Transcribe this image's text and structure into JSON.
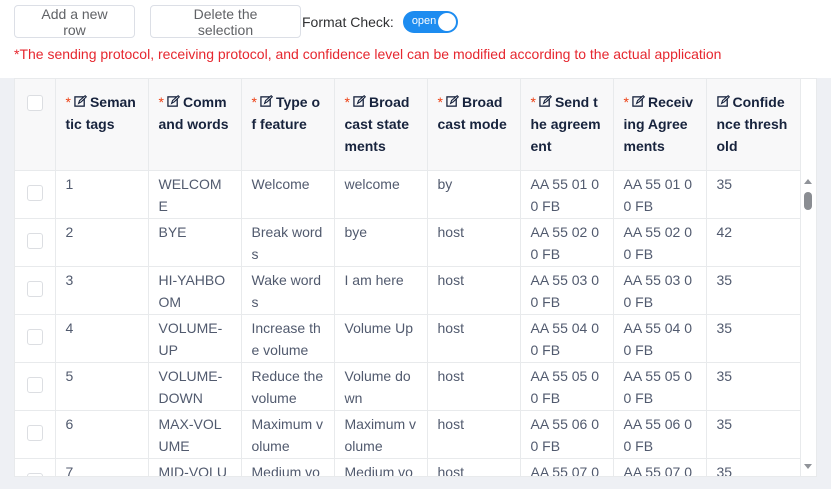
{
  "toolbar": {
    "add_label": "Add a new row",
    "delete_label": "Delete the selection",
    "format_check_label": "Format Check:",
    "toggle_text": "open"
  },
  "note": "*The sending protocol, receiving protocol, and confidence level can be modified according to the actual application",
  "columns": [
    {
      "required": "*",
      "label": "Semantic tags"
    },
    {
      "required": "*",
      "label": "Command words"
    },
    {
      "required": "*",
      "label": "Type of feature"
    },
    {
      "required": "*",
      "label": "Broadcast statements"
    },
    {
      "required": "*",
      "label": "Broadcast mode"
    },
    {
      "required": "*",
      "label": "Send the agreement"
    },
    {
      "required": "*",
      "label": "Receiving Agreements"
    },
    {
      "required": "",
      "label": "Confidence threshold"
    }
  ],
  "rows": [
    [
      "1",
      "WELCOME",
      "Welcome",
      "welcome",
      "by",
      "AA 55 01 00 FB",
      "AA 55 01 00 FB",
      "35"
    ],
    [
      "2",
      "BYE",
      "Break words",
      "bye",
      "host",
      "AA 55 02 00 FB",
      "AA 55 02 00 FB",
      "42"
    ],
    [
      "3",
      "HI-YAHBOOM",
      "Wake words",
      "I am here",
      "host",
      "AA 55 03 00 FB",
      "AA 55 03 00 FB",
      "35"
    ],
    [
      "4",
      "VOLUME-UP",
      "Increase the volume",
      "Volume Up",
      "host",
      "AA 55 04 00 FB",
      "AA 55 04 00 FB",
      "35"
    ],
    [
      "5",
      "VOLUME-DOWN",
      "Reduce the volume",
      "Volume down",
      "host",
      "AA 55 05 00 FB",
      "AA 55 05 00 FB",
      "35"
    ],
    [
      "6",
      "MAX-VOLUME",
      "Maximum volume",
      "Maximum volume",
      "host",
      "AA 55 06 00 FB",
      "AA 55 06 00 FB",
      "35"
    ],
    [
      "7",
      "MID-VOLU",
      "Medium vo",
      "Medium vo",
      "host",
      "AA 55 07 0",
      "AA 55 07 0",
      "35"
    ]
  ],
  "colors": {
    "note_red": "#e6272f",
    "toggle_blue": "#1d8cf0",
    "required_star": "#ed4014"
  }
}
